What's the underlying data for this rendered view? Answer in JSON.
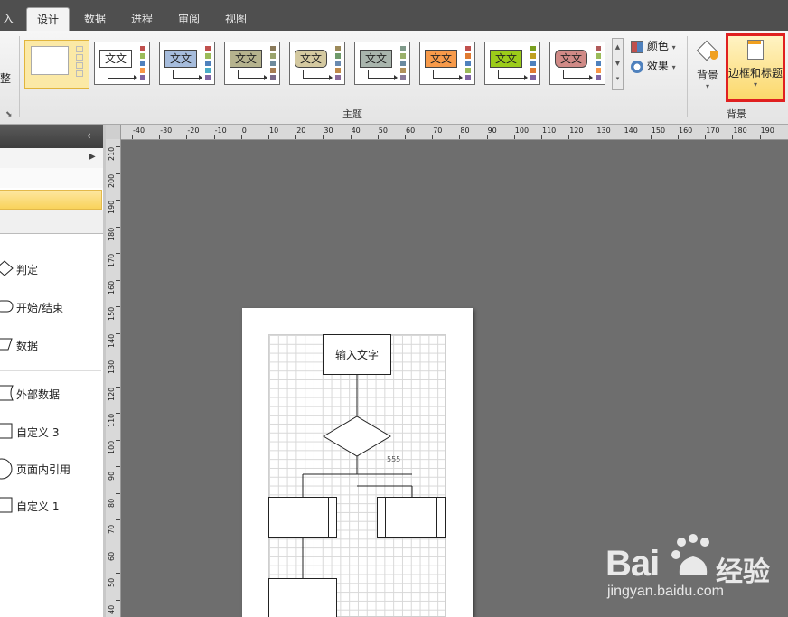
{
  "tabs": [
    {
      "label": "入",
      "active": false
    },
    {
      "label": "设计",
      "active": true
    },
    {
      "label": "数据",
      "active": false
    },
    {
      "label": "进程",
      "active": false
    },
    {
      "label": "审阅",
      "active": false
    },
    {
      "label": "视图",
      "active": false
    }
  ],
  "ribbon": {
    "left_group_label": "整",
    "theme_group_label": "主题",
    "theme_text": "文文",
    "colors_label": "颜色",
    "effects_label": "效果",
    "background_button": "背景",
    "borders_button": "边框和标题",
    "background_group_label": "背景"
  },
  "left_panel": {
    "shapes": [
      {
        "label": "判定",
        "icon": "diamond-icon"
      },
      {
        "label": "开始/结束",
        "icon": "terminator-icon"
      },
      {
        "label": "数据",
        "icon": "parallelogram-icon"
      },
      {
        "label": "外部数据",
        "icon": "external-data-icon"
      },
      {
        "label": "自定义 3",
        "icon": "rectangle-icon"
      },
      {
        "label": "页面内引用",
        "icon": "circle-icon"
      },
      {
        "label": "自定义 1",
        "icon": "card-icon"
      }
    ]
  },
  "ruler": {
    "top_labels": [
      "-40",
      "-30",
      "-20",
      "-10",
      "0",
      "10",
      "20",
      "30",
      "40",
      "50",
      "60",
      "70",
      "80",
      "90",
      "100",
      "110",
      "120",
      "130",
      "140",
      "150",
      "160",
      "170",
      "180",
      "190"
    ],
    "left_labels": [
      "210",
      "200",
      "190",
      "180",
      "170",
      "160",
      "150",
      "140",
      "130",
      "120",
      "110",
      "100",
      "90",
      "80",
      "70",
      "60",
      "50",
      "40"
    ]
  },
  "canvas": {
    "start_box_text": "输入文字",
    "diamond_label": "555"
  },
  "watermark": {
    "brand": "Bai",
    "brand_cn": "经验",
    "url": "jingyan.baidu.com"
  },
  "colors": {
    "highlight_red": "#e02020",
    "selected_gold": "#f6c945"
  }
}
